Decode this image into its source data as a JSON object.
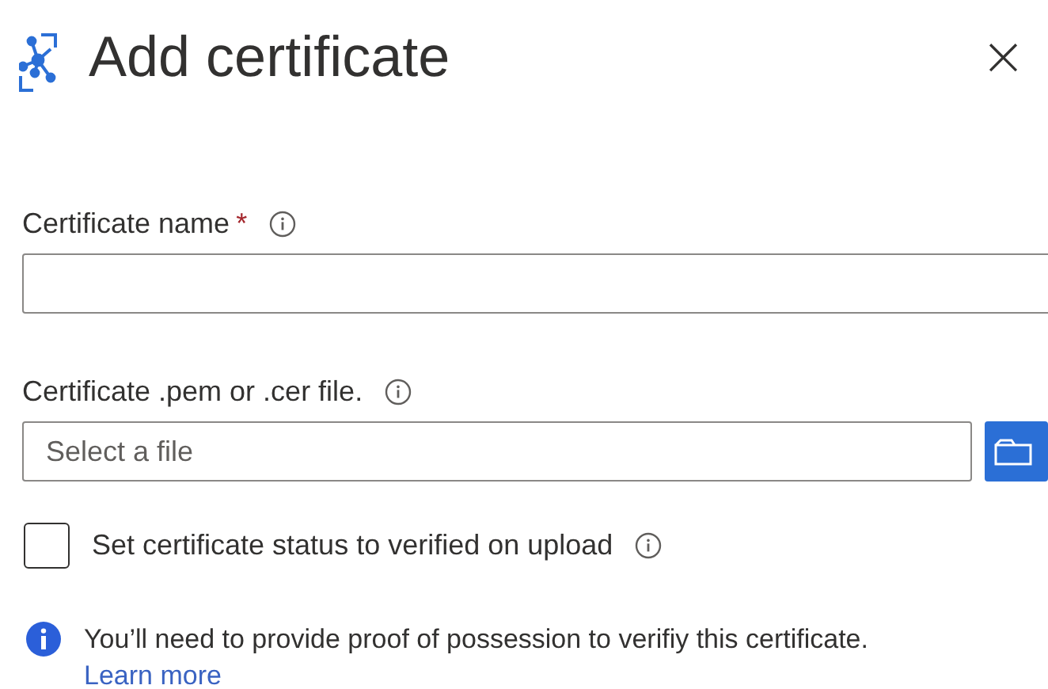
{
  "header": {
    "title": "Add certificate",
    "close": "×"
  },
  "fields": [
    {
      "kind": "text",
      "label": "Certificate name",
      "required": true,
      "required_mark": "*"
    },
    {
      "kind": "file",
      "label": "Certificate .pem or .cer file.",
      "required": false,
      "placeholder": "Select a file"
    }
  ],
  "checkbox": {
    "label": "Set certificate status to verified on upload",
    "checked": false
  },
  "note": {
    "text": "You’ll need to provide proof of possession to verifiy this certificate.",
    "link": "Learn more"
  }
}
